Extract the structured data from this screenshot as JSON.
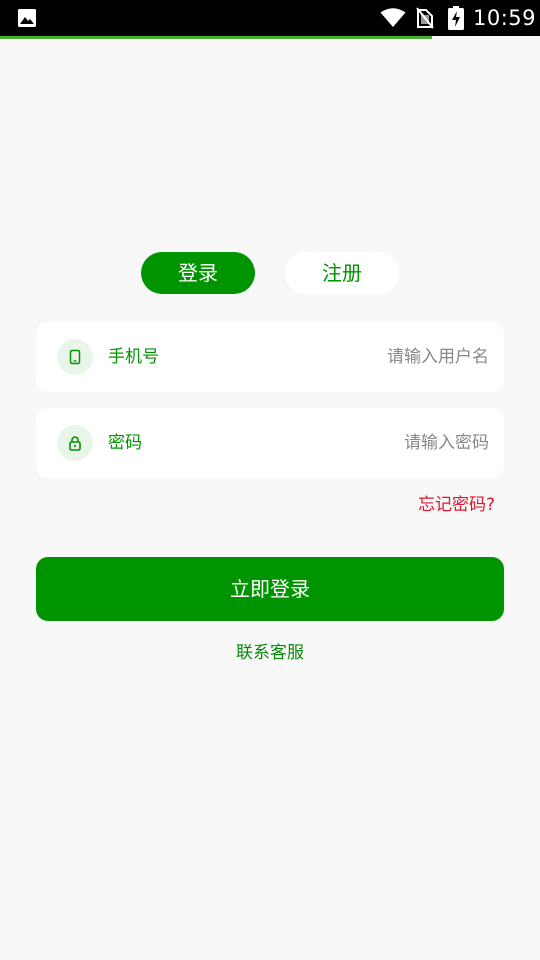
{
  "status_bar": {
    "time": "10:59",
    "icons": [
      "image-icon",
      "wifi-icon",
      "no-sim-icon",
      "battery-charging-icon"
    ]
  },
  "progress": {
    "fraction": 0.8,
    "color": "#4cae2f"
  },
  "tabs": [
    {
      "label": "登录",
      "active": true
    },
    {
      "label": "注册",
      "active": false
    }
  ],
  "form": {
    "phone": {
      "label": "手机号",
      "placeholder": "请输入用户名",
      "icon": "phone-icon"
    },
    "password": {
      "label": "密码",
      "placeholder": "请输入密码",
      "icon": "lock-icon"
    },
    "forgot": "忘记密码?"
  },
  "actions": {
    "submit": "立即登录",
    "service": "联系客服"
  },
  "colors": {
    "primary": "#009400",
    "danger": "#e0142e",
    "background": "#f8f8f9"
  }
}
